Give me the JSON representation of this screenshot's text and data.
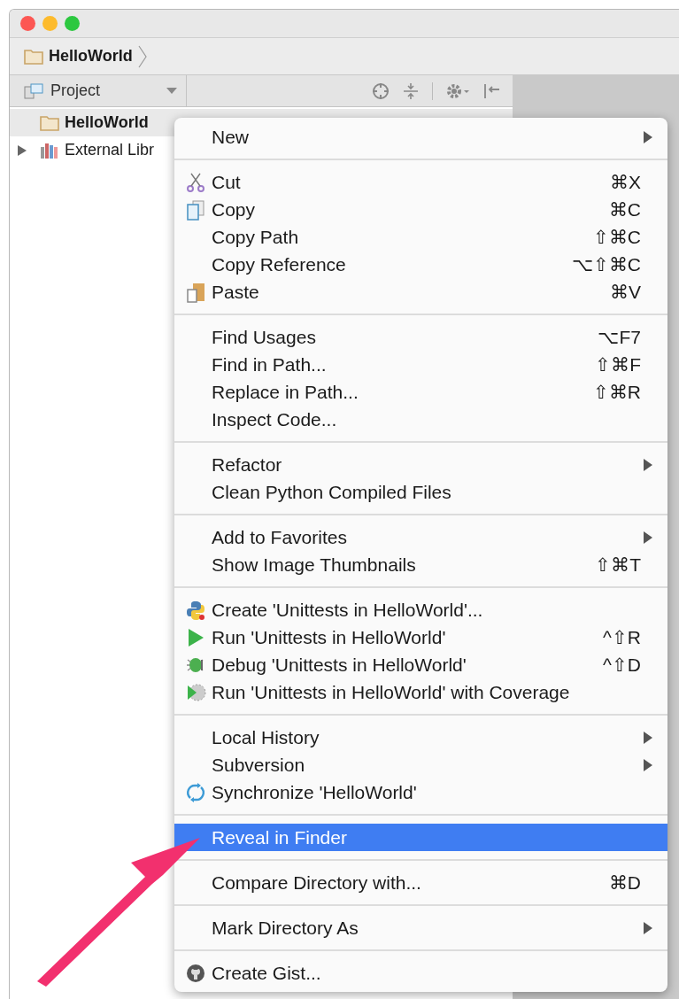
{
  "breadcrumb": {
    "label": "HelloWorld"
  },
  "panel": {
    "title": "Project"
  },
  "tree": [
    {
      "kind": "root",
      "label": "HelloWorld",
      "selected": true
    },
    {
      "kind": "library",
      "label": "External Libr",
      "selected": false
    }
  ],
  "menu": [
    {
      "kind": "item",
      "label": "New",
      "submenu": true,
      "selected": false
    },
    {
      "kind": "separator"
    },
    {
      "kind": "item",
      "label": "Cut",
      "shortcut": "⌘X",
      "selected": false
    },
    {
      "kind": "item",
      "label": "Copy",
      "shortcut": "⌘C",
      "selected": false
    },
    {
      "kind": "item",
      "label": "Copy Path",
      "shortcut": "⇧⌘C",
      "selected": false
    },
    {
      "kind": "item",
      "label": "Copy Reference",
      "shortcut": "⌥⇧⌘C",
      "selected": false
    },
    {
      "kind": "item",
      "label": "Paste",
      "shortcut": "⌘V",
      "selected": false
    },
    {
      "kind": "separator"
    },
    {
      "kind": "item",
      "label": "Find Usages",
      "shortcut": "⌥F7",
      "selected": false
    },
    {
      "kind": "item",
      "label": "Find in Path...",
      "shortcut": "⇧⌘F",
      "selected": false
    },
    {
      "kind": "item",
      "label": "Replace in Path...",
      "shortcut": "⇧⌘R",
      "selected": false
    },
    {
      "kind": "item",
      "label": "Inspect Code...",
      "selected": false
    },
    {
      "kind": "separator"
    },
    {
      "kind": "item",
      "label": "Refactor",
      "submenu": true,
      "selected": false
    },
    {
      "kind": "item",
      "label": "Clean Python Compiled Files",
      "selected": false
    },
    {
      "kind": "separator"
    },
    {
      "kind": "item",
      "label": "Add to Favorites",
      "submenu": true,
      "selected": false
    },
    {
      "kind": "item",
      "label": "Show Image Thumbnails",
      "shortcut": "⇧⌘T",
      "selected": false
    },
    {
      "kind": "separator"
    },
    {
      "kind": "item",
      "label": "Create 'Unittests in HelloWorld'...",
      "selected": false
    },
    {
      "kind": "item",
      "label": "Run 'Unittests in HelloWorld'",
      "shortcut": "^⇧R",
      "selected": false
    },
    {
      "kind": "item",
      "label": "Debug 'Unittests in HelloWorld'",
      "shortcut": "^⇧D",
      "selected": false
    },
    {
      "kind": "item",
      "label": "Run 'Unittests in HelloWorld' with Coverage",
      "selected": false
    },
    {
      "kind": "separator"
    },
    {
      "kind": "item",
      "label": "Local History",
      "submenu": true,
      "selected": false
    },
    {
      "kind": "item",
      "label": "Subversion",
      "submenu": true,
      "selected": false
    },
    {
      "kind": "item",
      "label": "Synchronize 'HelloWorld'",
      "selected": false
    },
    {
      "kind": "separator"
    },
    {
      "kind": "item",
      "label": "Reveal in Finder",
      "selected": true
    },
    {
      "kind": "separator"
    },
    {
      "kind": "item",
      "label": "Compare Directory with...",
      "shortcut": "⌘D",
      "selected": false
    },
    {
      "kind": "separator"
    },
    {
      "kind": "item",
      "label": "Mark Directory As",
      "submenu": true,
      "selected": false
    },
    {
      "kind": "separator"
    },
    {
      "kind": "item",
      "label": "Create Gist...",
      "selected": false
    }
  ]
}
